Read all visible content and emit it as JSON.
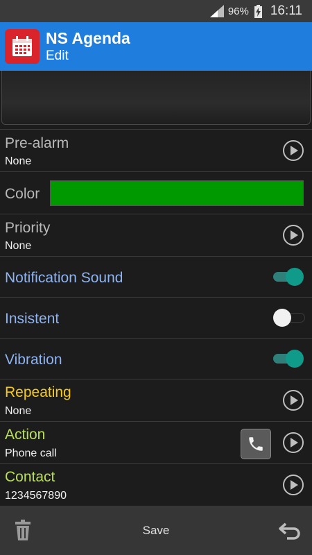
{
  "status_bar": {
    "battery_pct": "96%",
    "time": "16:11"
  },
  "app_bar": {
    "title": "NS Agenda",
    "subtitle": "Edit"
  },
  "settings": {
    "pre_alarm": {
      "title": "Pre-alarm",
      "value": "None"
    },
    "color": {
      "title": "Color",
      "swatch": "#009a00"
    },
    "priority": {
      "title": "Priority",
      "value": "None"
    },
    "notification_sound": {
      "title": "Notification Sound",
      "enabled": true
    },
    "insistent": {
      "title": "Insistent",
      "enabled": false
    },
    "vibration": {
      "title": "Vibration",
      "enabled": true
    },
    "repeating": {
      "title": "Repeating",
      "value": "None"
    },
    "action": {
      "title": "Action",
      "value": "Phone call"
    },
    "contact": {
      "title": "Contact",
      "value": "1234567890"
    }
  },
  "bottom_bar": {
    "save_label": "Save"
  },
  "icons": [
    "signal-icon",
    "battery-charging-icon",
    "calendar-icon",
    "play-icon",
    "phone-icon",
    "trash-icon",
    "undo-icon"
  ]
}
